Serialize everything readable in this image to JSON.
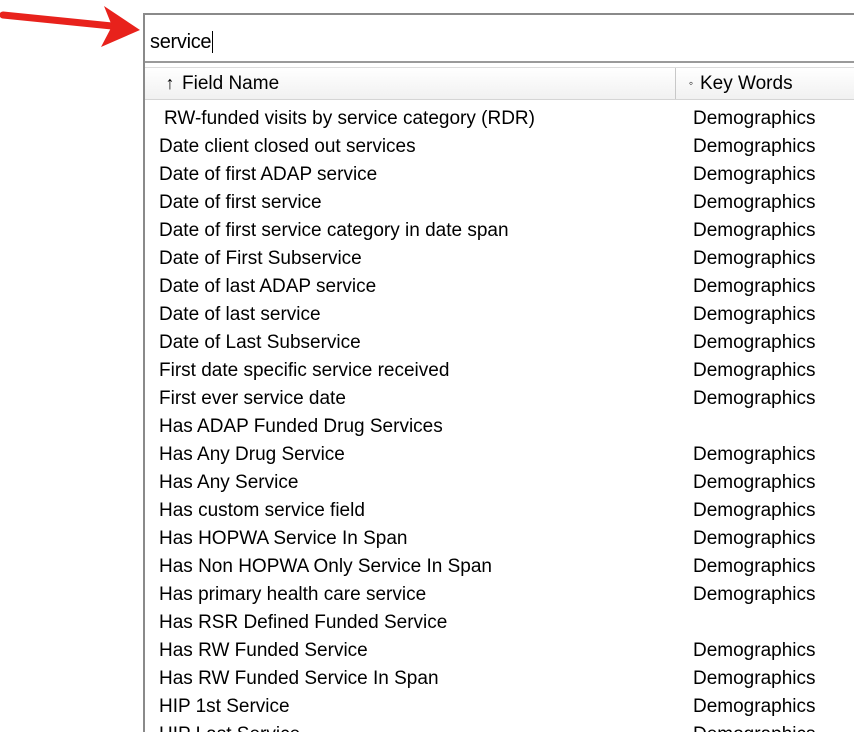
{
  "search": {
    "value": "service"
  },
  "header": {
    "field_name_label": "Field Name",
    "field_name_sort_icon": "up-arrow-sort-icon",
    "key_words_label": "Key Words",
    "key_words_icon": "small-circle-icon"
  },
  "annotation": {
    "arrow_color": "#e8221c",
    "arrow_icon": "red-arrow-pointing-right"
  },
  "rows": [
    {
      "name": "RW-funded visits by service category (RDR)",
      "keywords": "Demographics"
    },
    {
      "name": "Date client closed out services",
      "keywords": "Demographics"
    },
    {
      "name": "Date of first ADAP service",
      "keywords": "Demographics"
    },
    {
      "name": "Date of first service",
      "keywords": "Demographics"
    },
    {
      "name": "Date of first service category in date span",
      "keywords": "Demographics"
    },
    {
      "name": "Date of First Subservice",
      "keywords": "Demographics"
    },
    {
      "name": "Date of last ADAP service",
      "keywords": "Demographics"
    },
    {
      "name": "Date of last service",
      "keywords": "Demographics"
    },
    {
      "name": "Date of Last Subservice",
      "keywords": "Demographics"
    },
    {
      "name": "First date specific service received",
      "keywords": "Demographics"
    },
    {
      "name": "First ever service date",
      "keywords": "Demographics"
    },
    {
      "name": "Has ADAP Funded Drug Services",
      "keywords": ""
    },
    {
      "name": "Has Any Drug Service",
      "keywords": "Demographics"
    },
    {
      "name": "Has Any Service",
      "keywords": "Demographics"
    },
    {
      "name": "Has custom service field",
      "keywords": "Demographics"
    },
    {
      "name": "Has HOPWA Service In Span",
      "keywords": "Demographics"
    },
    {
      "name": "Has Non HOPWA Only Service In Span",
      "keywords": "Demographics"
    },
    {
      "name": "Has primary health care service",
      "keywords": "Demographics"
    },
    {
      "name": "Has RSR Defined Funded Service",
      "keywords": ""
    },
    {
      "name": "Has RW Funded Service",
      "keywords": "Demographics"
    },
    {
      "name": "Has RW Funded Service In Span",
      "keywords": "Demographics"
    },
    {
      "name": "HIP 1st Service",
      "keywords": "Demographics"
    },
    {
      "name": "HIP Last Service",
      "keywords": "Demographics"
    }
  ]
}
